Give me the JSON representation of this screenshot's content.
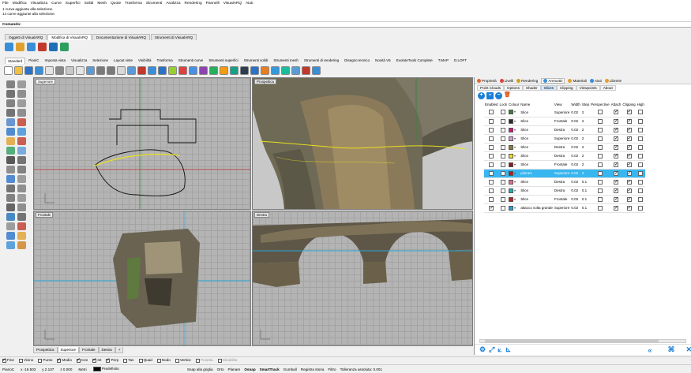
{
  "menubar": [
    "File",
    "Modifica",
    "Visualizza",
    "Curve",
    "Superfici",
    "Solidi",
    "Mesh",
    "Quote",
    "Trasforma",
    "Strumenti",
    "Analizza",
    "Rendering",
    "Pannelli",
    "VisualARQ",
    "Aiuti"
  ],
  "command": {
    "history": [
      "1 curva aggiunta alla selezione.",
      "14 curve aggiunte alla selezione."
    ],
    "prompt": "Comando:"
  },
  "toolbar_tabs_top": [
    "Oggetti di VisualARQ",
    "Modifica di VisualARQ",
    "Documentazione di VisualARQ",
    "Strumenti di VisualARQ"
  ],
  "toolbar_tabs_main": [
    "Standard",
    "PianiC",
    "Imposta vista",
    "Visualizza",
    "Selezione",
    "Layout viste",
    "Visibilità",
    "Trasforma",
    "Strumenti curve",
    "Strumenti superfici",
    "Strumenti solidi",
    "Strumenti mesh",
    "Strumenti di rendering",
    "Disegno tecnico",
    "Novità V6",
    "EvoluteTools Complete",
    "T.MAP",
    "D.LOFT"
  ],
  "viewports": {
    "top": "Superiore",
    "perspective": "Prospettica",
    "front": "Frontale",
    "right": "Destra"
  },
  "viewport_tabs": [
    "Prospettica",
    "Superiore",
    "Frontale",
    "Destra"
  ],
  "viewport_tab_add": "+",
  "panel": {
    "tabs": [
      "Proprietà",
      "Livelli",
      "Rendering",
      "Arena4D",
      "Materiali",
      "Aiuti",
      "Librerie"
    ],
    "subtabs": [
      "Point Clouds",
      "Options",
      "Shader",
      "Slices",
      "Clipping",
      "Viewpoints",
      "About"
    ],
    "columns": [
      "Enabled",
      "Lock",
      "Colour",
      "Name",
      "View",
      "Width",
      "Step",
      "Perspective",
      "Attach",
      "Clipping",
      "High"
    ],
    "rows": [
      {
        "enabled": false,
        "lock": false,
        "color": "#3a7d3a",
        "name": "Slice",
        "view": "Superiore",
        "width": "0.02",
        "step": "2",
        "persp": false,
        "attach": true,
        "clip": true,
        "sel": false
      },
      {
        "enabled": false,
        "lock": false,
        "color": "#2b2b2b",
        "name": "Slice",
        "view": "Frontale",
        "width": "0.02",
        "step": "2",
        "persp": false,
        "attach": true,
        "clip": true,
        "sel": false
      },
      {
        "enabled": false,
        "lock": false,
        "color": "#d4157a",
        "name": "Slice",
        "view": "Destra",
        "width": "0.02",
        "step": "2",
        "persp": false,
        "attach": true,
        "clip": true,
        "sel": false
      },
      {
        "enabled": false,
        "lock": false,
        "color": "#d8a0d8",
        "name": "Slice",
        "view": "Superiore",
        "width": "0.02",
        "step": "2",
        "persp": false,
        "attach": true,
        "clip": true,
        "sel": false
      },
      {
        "enabled": false,
        "lock": false,
        "color": "#8c7a3a",
        "name": "Slice",
        "view": "Destra",
        "width": "0.02",
        "step": "2",
        "persp": false,
        "attach": true,
        "clip": true,
        "sel": false
      },
      {
        "enabled": false,
        "lock": false,
        "color": "#f0e020",
        "name": "Slice",
        "view": "Destra",
        "width": "0.02",
        "step": "2",
        "persp": false,
        "attach": true,
        "clip": true,
        "sel": false
      },
      {
        "enabled": false,
        "lock": false,
        "color": "#8a1a1a",
        "name": "Slice",
        "view": "Frontale",
        "width": "0.02",
        "step": "2",
        "persp": false,
        "attach": true,
        "clip": true,
        "sel": false
      },
      {
        "enabled": false,
        "lock": false,
        "color": "#b01f1f",
        "name": "pilone1",
        "view": "Superiore",
        "width": "0.02",
        "step": "2",
        "persp": false,
        "attach": true,
        "clip": true,
        "sel": true
      },
      {
        "enabled": false,
        "lock": false,
        "color": "#e07090",
        "name": "Slice",
        "view": "Destra",
        "width": "0.02",
        "step": "0.1",
        "persp": false,
        "attach": true,
        "clip": true,
        "sel": false
      },
      {
        "enabled": false,
        "lock": false,
        "color": "#20b0b0",
        "name": "Slice",
        "view": "Destra",
        "width": "0.02",
        "step": "0.1",
        "persp": false,
        "attach": true,
        "clip": true,
        "sel": false
      },
      {
        "enabled": false,
        "lock": false,
        "color": "#c02020",
        "name": "Slice",
        "view": "Frontale",
        "width": "0.02",
        "step": "0.1",
        "persp": false,
        "attach": true,
        "clip": true,
        "sel": false
      },
      {
        "enabled": true,
        "lock": false,
        "color": "#28a0d8",
        "name": "attacco volta grande",
        "view": "Superiore",
        "width": "0.02",
        "step": "0.1",
        "persp": false,
        "attach": true,
        "clip": true,
        "sel": false
      }
    ]
  },
  "osnap": [
    {
      "label": "Fine",
      "on": true
    },
    {
      "label": "Vicino",
      "on": false
    },
    {
      "label": "Punto",
      "on": false
    },
    {
      "label": "Medio",
      "on": true
    },
    {
      "label": "Cen",
      "on": true
    },
    {
      "label": "Int",
      "on": true
    },
    {
      "label": "Perp",
      "on": true
    },
    {
      "label": "Tan",
      "on": false
    },
    {
      "label": "Quad",
      "on": false
    },
    {
      "label": "Nodo",
      "on": false
    },
    {
      "label": "Vertice",
      "on": false
    },
    {
      "label": "Proietta",
      "on": false
    },
    {
      "label": "Disabilita",
      "on": false
    }
  ],
  "status": {
    "cplane": "PianoC",
    "x": "x -16.503",
    "y": "y 2.107",
    "z": "z 0.000",
    "units": "Metri",
    "layer": "Predefinito",
    "toggles": [
      "Snap alla griglia",
      "Orto",
      "Planare",
      "Osnap",
      "SmartTrack",
      "Gumball",
      "Registra storia",
      "Filtro",
      "Tolleranza assoluta: 0.001"
    ],
    "bold": [
      "Osnap",
      "SmartTrack"
    ]
  },
  "colors": {
    "accent": "#1c7fd6",
    "selection": "#38b6f0",
    "viewport": "#b4b4b4"
  }
}
